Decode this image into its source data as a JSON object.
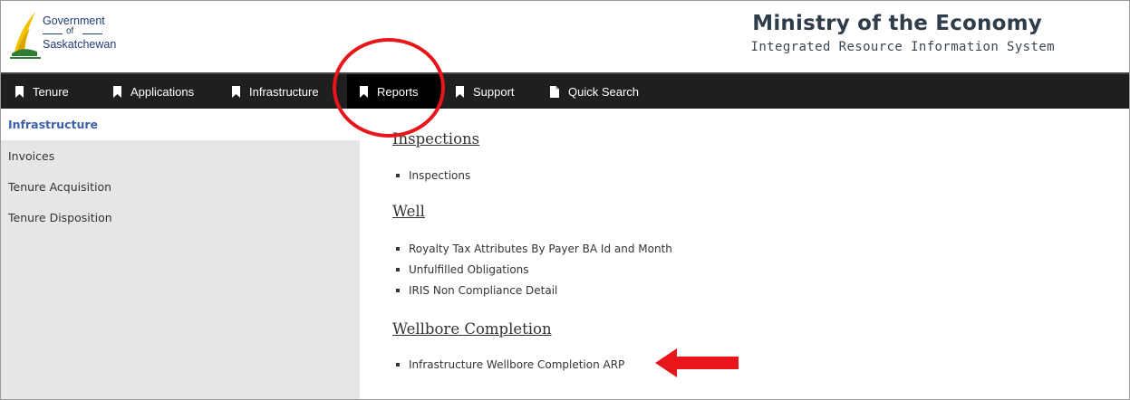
{
  "header": {
    "gov_line1": "Government",
    "gov_of": "of",
    "gov_line3": "Saskatchewan",
    "ministry_title": "Ministry of the Economy",
    "system_title": "Integrated Resource Information System"
  },
  "nav": {
    "items": [
      {
        "label": "Tenure",
        "icon": "bookmark-icon"
      },
      {
        "label": "Applications",
        "icon": "bookmark-icon"
      },
      {
        "label": "Infrastructure",
        "icon": "bookmark-icon"
      },
      {
        "label": "Reports",
        "icon": "bookmark-icon",
        "active": true
      },
      {
        "label": "Support",
        "icon": "bookmark-icon"
      },
      {
        "label": "Quick Search",
        "icon": "document-icon"
      }
    ]
  },
  "sidebar": {
    "items": [
      {
        "label": "Infrastructure",
        "active": true
      },
      {
        "label": "Invoices"
      },
      {
        "label": "Tenure Acquisition"
      },
      {
        "label": "Tenure Disposition"
      }
    ]
  },
  "main": {
    "sections": [
      {
        "title": "Inspections",
        "items": [
          "Inspections"
        ]
      },
      {
        "title": "Well",
        "items": [
          "Royalty Tax Attributes By Payer BA Id and Month",
          "Unfulfilled Obligations",
          "IRIS Non Compliance Detail"
        ]
      },
      {
        "title": "Wellbore Completion",
        "items": [
          "Infrastructure Wellbore Completion ARP"
        ]
      }
    ]
  },
  "colors": {
    "nav_bg": "#1f1f1f",
    "sidebar_bg": "#e6e6e6",
    "sidebar_active_text": "#3b5fa8",
    "annotation_red": "#e8151b",
    "logo_green": "#2e7d32",
    "logo_yellow": "#f2c200"
  }
}
